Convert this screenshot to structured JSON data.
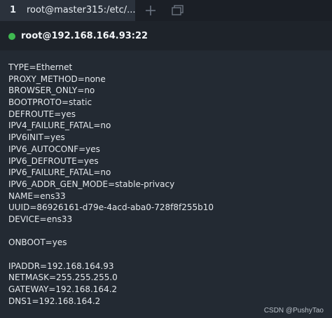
{
  "tab": {
    "number": "1",
    "title": "root@master315:/etc/..."
  },
  "session": {
    "title": "root@192.168.164.93:22",
    "status_color": "#3fb950"
  },
  "icons": {
    "new_tab": "plus-icon",
    "tab_list": "window-list-icon"
  },
  "terminal": {
    "lines_group1": [
      "TYPE=Ethernet",
      "PROXY_METHOD=none",
      "BROWSER_ONLY=no",
      "BOOTPROTO=static",
      "DEFROUTE=yes",
      "IPV4_FAILURE_FATAL=no",
      "IPV6INIT=yes",
      "IPV6_AUTOCONF=yes",
      "IPV6_DEFROUTE=yes",
      "IPV6_FAILURE_FATAL=no",
      "IPV6_ADDR_GEN_MODE=stable-privacy",
      "NAME=ens33",
      "UUID=86926161-d79e-4acd-aba0-728f8f255b10",
      "DEVICE=ens33"
    ],
    "lines_group2": [
      "ONBOOT=yes"
    ],
    "lines_group3": [
      "IPADDR=192.168.164.93",
      "NETMASK=255.255.255.0",
      "GATEWAY=192.168.164.2",
      "DNS1=192.168.164.2"
    ]
  },
  "watermark": "CSDN @PushyTao"
}
